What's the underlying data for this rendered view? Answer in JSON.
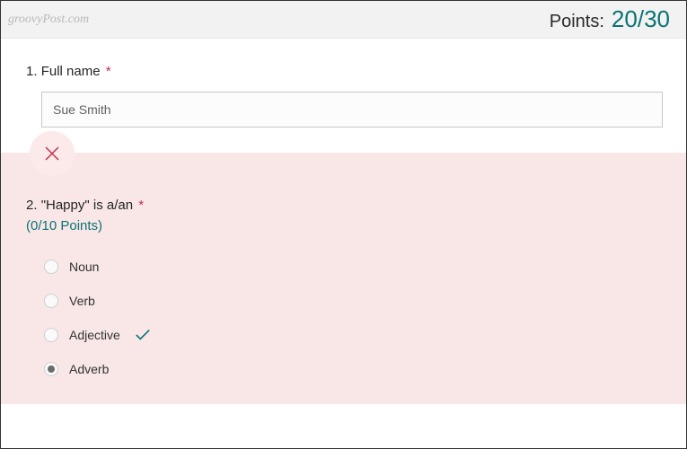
{
  "watermark": "groovyPost.com",
  "header": {
    "points_label": "Points:",
    "points_value": "20/30"
  },
  "q1": {
    "number": "1.",
    "title": "Full name",
    "required": "*",
    "value": "Sue Smith"
  },
  "q2": {
    "number": "2.",
    "title": "\"Happy\" is a/an",
    "required": "*",
    "score": "(0/10 Points)",
    "options": {
      "o0": "Noun",
      "o1": "Verb",
      "o2": "Adjective",
      "o3": "Adverb"
    },
    "correct_index": 2,
    "selected_index": 3
  }
}
